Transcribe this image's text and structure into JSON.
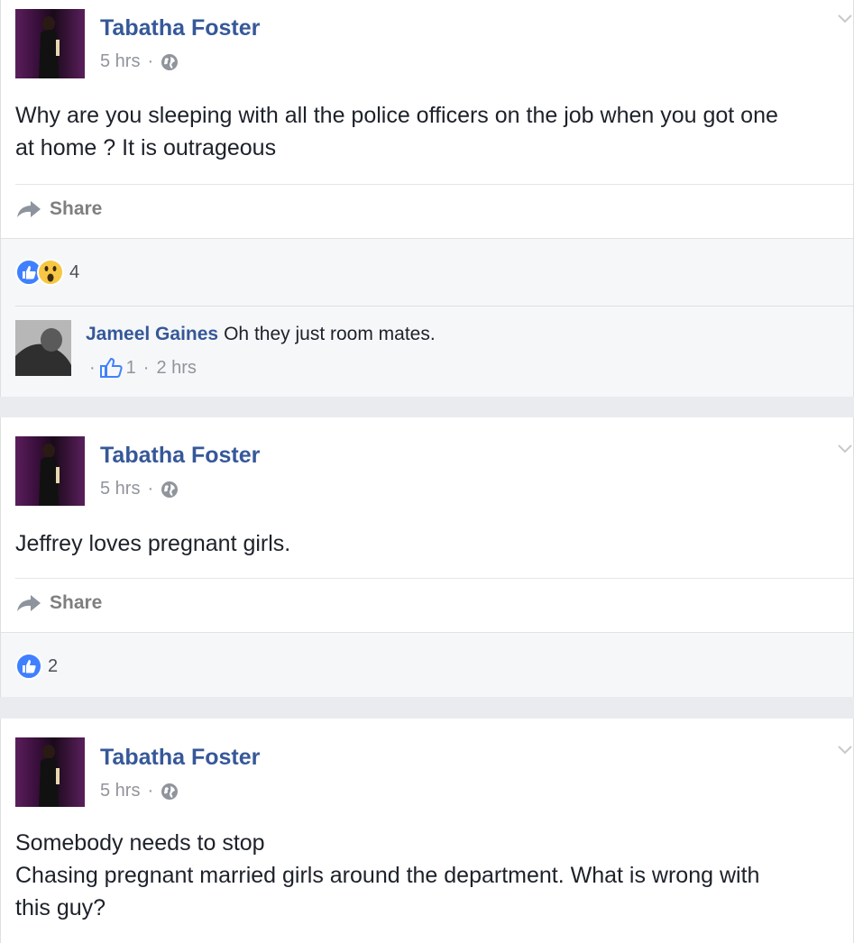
{
  "posts": [
    {
      "author": "Tabatha Foster",
      "time": "5 hrs",
      "text": [
        "Why are you sleeping with all the police officers on the job when you got one",
        "at home ? It is outrageous"
      ],
      "share_label": "Share",
      "reaction_count": "4",
      "reactions": [
        "like-icon",
        "wow-icon"
      ],
      "comment": {
        "author": "Jameel Gaines",
        "text": "Oh they just room mates.",
        "like_count": "1",
        "time": "2 hrs"
      }
    },
    {
      "author": "Tabatha Foster",
      "time": "5 hrs",
      "text": [
        "Jeffrey loves pregnant girls."
      ],
      "share_label": "Share",
      "reaction_count": "2",
      "reactions": [
        "like-icon"
      ]
    },
    {
      "author": "Tabatha Foster",
      "time": "5 hrs",
      "text": [
        "Somebody needs to stop",
        "Chasing pregnant married girls around the department. What is wrong with",
        "this guy?"
      ]
    }
  ],
  "colors": {
    "link": "#365899",
    "like": "#4080ff",
    "background": "#e9ebee"
  }
}
